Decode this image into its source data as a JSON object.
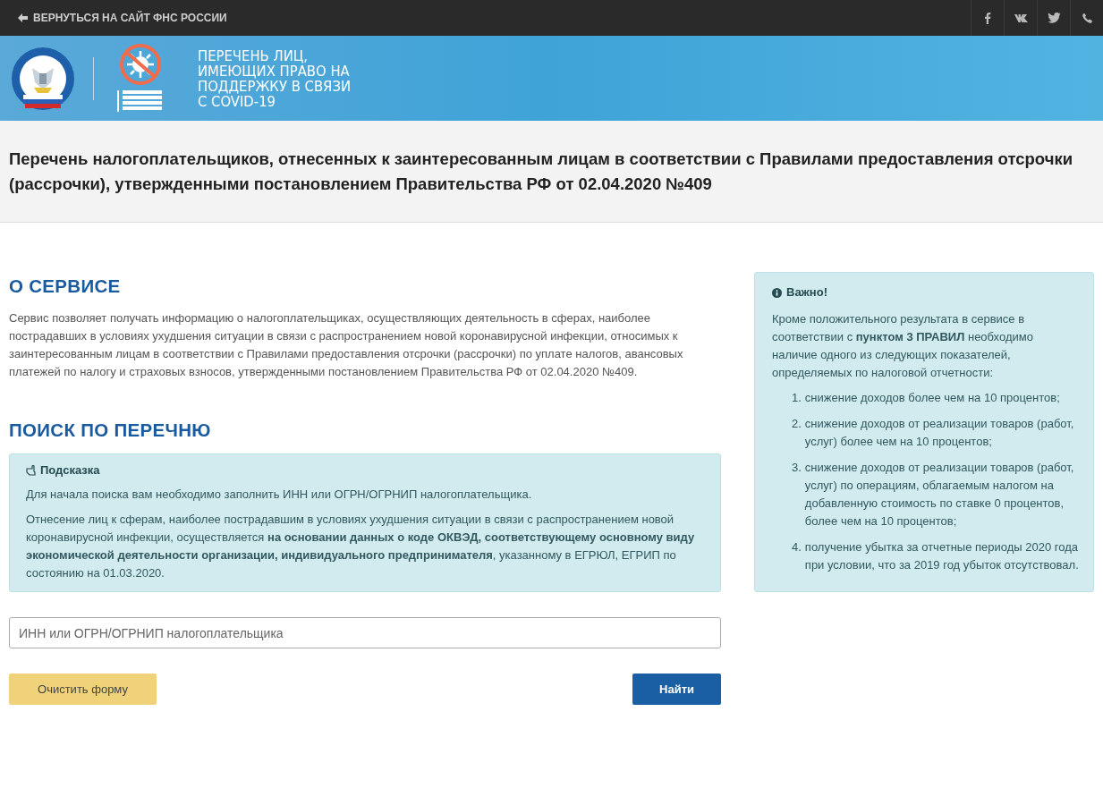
{
  "top_bar": {
    "back_link": "ВЕРНУТЬСЯ НА САЙТ ФНС РОССИИ",
    "social_buttons": [
      {
        "kind": "facebook"
      },
      {
        "kind": "vk"
      },
      {
        "kind": "twitter"
      },
      {
        "kind": "phone"
      }
    ]
  },
  "banner": {
    "title_lines": [
      "ПЕРЕЧЕНЬ ЛИЦ,",
      "ИМЕЮЩИХ ПРАВО НА",
      "ПОДДЕРЖКУ В СВЯЗИ",
      "С COVID-19"
    ]
  },
  "page_title": "Перечень налогоплательщиков, отнесенных к заинтересованным лицам в соответствии с Правилами предоставления отсрочки (рассрочки), утвержденными постановлением Правительства РФ от 02.04.2020 №409",
  "about": {
    "heading": "О СЕРВИСЕ",
    "text": "Сервис позволяет получать информацию о налогоплательщиках, осуществляющих деятельность в сферах, наиболее пострадавших в условиях ухудшения ситуации в связи с распространением новой коронавирусной инфекции, относимых к заинтересованным лицам в соответствии с Правилами предоставления отсрочки (рассрочки) по уплате налогов, авансовых платежей по налогу и страховых взносов, утвержденными постановлением Правительства РФ от 02.04.2020 №409."
  },
  "search": {
    "heading": "ПОИСК ПО ПЕРЕЧНЮ",
    "hint": {
      "title": "Подсказка",
      "paragraphs": [
        "Для начала поиска вам необходимо заполнить ИНН или ОГРН/ОГРНИП налогоплательщика.",
        "Отнесение лиц к сферам, наиболее пострадавшим в условиях ухудшения ситуации в связи с распространением новой коронавирусной инфекции, осуществляется **на основании данных о коде ОКВЭД, соответствующему основному виду экономической деятельности организации, индивидуального предпринимателя**, указанному в ЕГРЮЛ, ЕГРИП по состоянию на 01.03.2020."
      ]
    },
    "input": {
      "placeholder": "ИНН или ОГРН/ОГРНИП налогоплательщика"
    },
    "clear_button": "Очистить форму",
    "find_button": "Найти"
  },
  "important": {
    "title": "Важно!",
    "text": "Кроме положительного результата в сервисе в соответствии с **пунктом 3 ПРАВИЛ** необходимо наличие одного из следующих показателей, определяемых по налоговой отчетности:",
    "items": [
      {
        "number": "1.",
        "text": "снижение доходов более чем на 10 процентов;"
      },
      {
        "number": "2.",
        "text": "снижение доходов от реализации товаров (работ, услуг) более чем на 10 процентов;"
      },
      {
        "number": "3.",
        "text": "снижение доходов от реализации товаров (работ, услуг) по операциям, облагаемым налогом на добавленную стоимость по ставке 0 процентов, более чем на 10 процентов;"
      },
      {
        "number": "4.",
        "text": "получение убытка за отчетные периоды 2020 года при условии, что за 2019 год убыток отсутствовал."
      }
    ]
  }
}
